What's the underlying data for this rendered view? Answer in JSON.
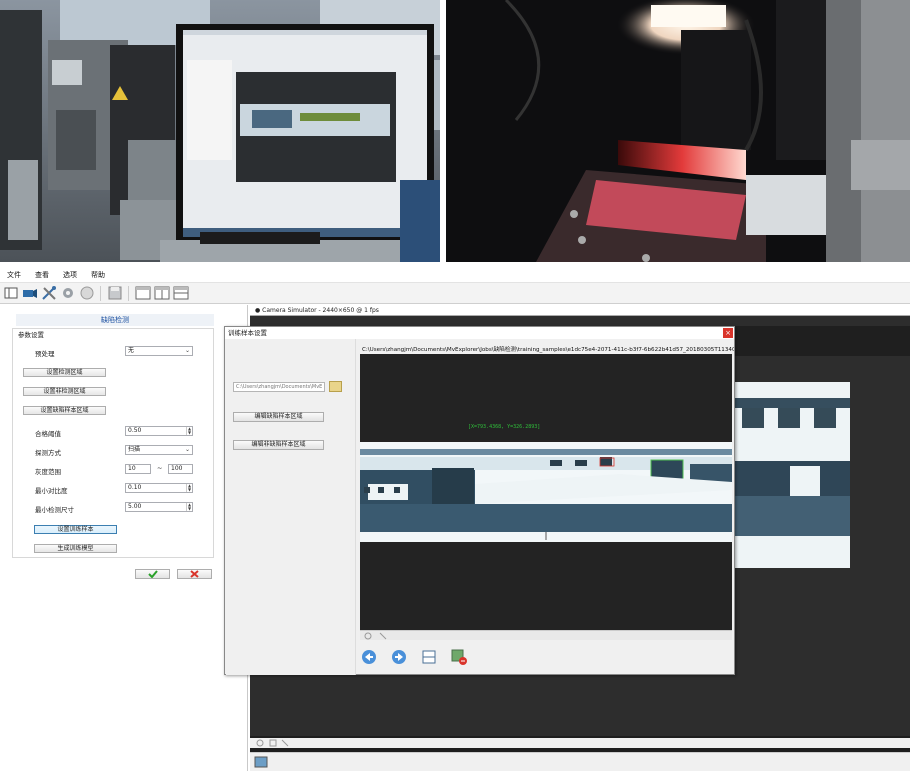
{
  "menu": [
    "文件",
    "查看",
    "选项",
    "帮助"
  ],
  "left_panel": {
    "title": "缺陷检测",
    "group": "参数设置",
    "preprocess_label": "预处理",
    "preprocess_value": "无",
    "btn_set_detect": "设置检测区域",
    "btn_set_nondetect": "设置非检测区域",
    "btn_set_defect_sample": "设置缺陷样本区域",
    "threshold_label": "合格阈值",
    "threshold_value": "0.50",
    "method_label": "探测方式",
    "method_value": "扫描",
    "gray_label": "灰度范围",
    "gray_min": "10",
    "gray_sep": "~",
    "gray_max": "100",
    "contrast_label": "最小对比度",
    "contrast_value": "0.10",
    "size_label": "最小检测尺寸",
    "size_value": "5.00",
    "btn_train_sample": "设置训练样本",
    "btn_gen_model": "生成训练模型"
  },
  "image_window": {
    "title": "Camera Simulator - 2440×650 @ 1 fps"
  },
  "dialog": {
    "title": "训练样本设置",
    "close": "×",
    "path": "C:\\Users\\zhangjm\\Documents\\MvE",
    "btn_edit_defect": "编辑缺陷样本区域",
    "btn_edit_nondefect": "编辑非缺陷样本区域",
    "file_path": "C:\\Users\\zhangjm\\Documents\\MvExplorer\\Jobs\\缺陷检测\\training_samples\\e1dc75e4-2071-411c-b3f7-6b622b41d57_20180305T113405.44",
    "coord_readout": "[X=793.4368, Y=326.2893]"
  },
  "colors": {
    "accent": "#1a4fa0",
    "ok": "#2aa12a",
    "cancel": "#d9342b",
    "overlay_text": "#2fbf3a"
  }
}
